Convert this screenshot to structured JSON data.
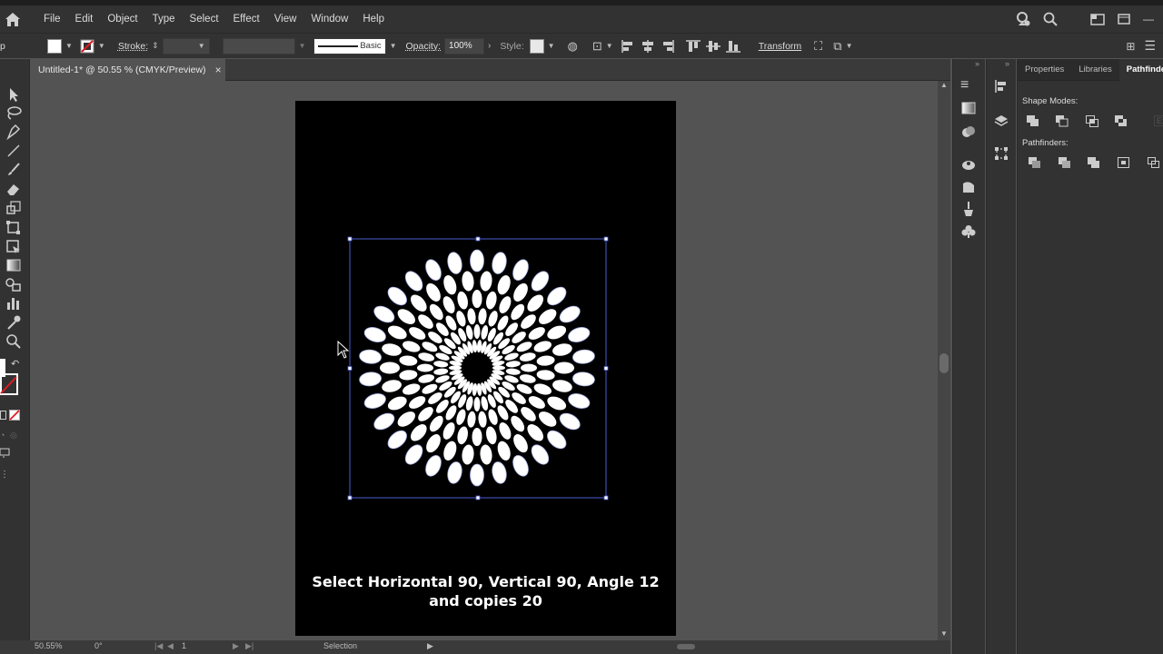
{
  "menubar": {
    "items": [
      "File",
      "Edit",
      "Object",
      "Type",
      "Select",
      "Effect",
      "View",
      "Window",
      "Help"
    ]
  },
  "control_bar": {
    "left_cutoff_label": "p",
    "fill_color": "#ffffff",
    "stroke_label": "Stroke:",
    "stroke_weight": "",
    "profile_label": "Basic",
    "opacity_label": "Opacity:",
    "opacity_value": "100%",
    "style_label": "Style:",
    "transform_label": "Transform"
  },
  "document_tab": {
    "title": "Untitled-1* @ 50.55 % (CMYK/Preview)",
    "close": "×"
  },
  "right_panel": {
    "tabs": [
      "Properties",
      "Libraries",
      "Pathfinder"
    ],
    "active_tab": "Pathfinder",
    "shape_modes_label": "Shape Modes:",
    "pathfinders_label": "Pathfinders:",
    "shape_modes_buttons": [
      "unite",
      "minus-front",
      "intersect",
      "exclude"
    ],
    "expand_label": "Ex",
    "pathfinder_buttons": [
      "divide",
      "trim",
      "merge",
      "crop",
      "outline"
    ]
  },
  "artboard": {
    "background": "#000000",
    "artwork": "radial petal flower pattern",
    "petal_color": "#ffffff",
    "selection_color": "#4a5ecf",
    "caption_line1": "Select Horizontal 90, Vertical 90, Angle 12",
    "caption_line2": "and copies 20"
  },
  "status_bar": {
    "zoom": "50.55%",
    "rotation": "0°",
    "artboard_number": "1",
    "tool_status": "Selection"
  }
}
